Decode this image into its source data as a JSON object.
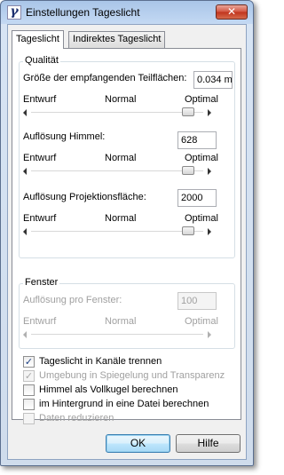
{
  "window": {
    "title": "Einstellungen Tageslicht",
    "close_label": "✕"
  },
  "tabs": [
    {
      "label": "Tageslicht",
      "active": true
    },
    {
      "label": "Indirektes Tageslicht",
      "active": false
    }
  ],
  "quality": {
    "title": "Qualität",
    "size_label": "Größe der empfangenden Teilflächen:",
    "size_value": "0.034 m",
    "scale": {
      "left": "Entwurf",
      "mid": "Normal",
      "right": "Optimal"
    },
    "sky_label": "Auflösung Himmel:",
    "sky_value": "628",
    "projection_label": "Auflösung Projektionsfläche:",
    "projection_value": "2000"
  },
  "window_group": {
    "title": "Fenster",
    "per_window_label": "Auflösung pro Fenster:",
    "per_window_value": "100",
    "scale": {
      "left": "Entwurf",
      "mid": "Normal",
      "right": "Optimal"
    }
  },
  "options": [
    {
      "label": "Tageslicht in Kanäle trennen",
      "checked": true,
      "enabled": true
    },
    {
      "label": "Umgebung in Spiegelung und Transparenz",
      "checked": true,
      "enabled": false
    },
    {
      "label": "Himmel als Vollkugel berechnen",
      "checked": false,
      "enabled": true
    },
    {
      "label": "im Hintergrund in eine Datei berechnen",
      "checked": false,
      "enabled": true
    },
    {
      "label": "Daten reduzieren",
      "checked": false,
      "enabled": false
    }
  ],
  "sliders": {
    "size": 0.95,
    "sky": 0.95,
    "projection": 0.95,
    "window": 0.0
  },
  "buttons": {
    "ok": "OK",
    "help": "Hilfe"
  }
}
